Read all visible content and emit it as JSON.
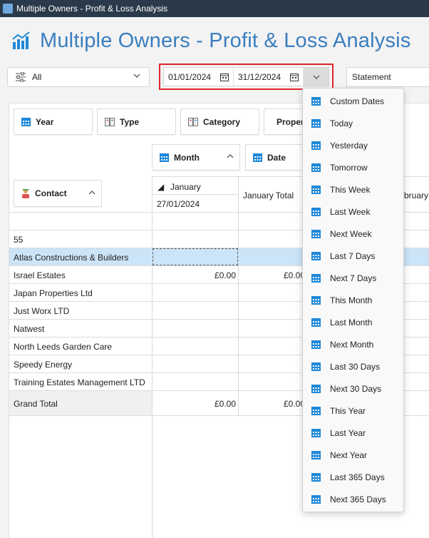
{
  "window": {
    "title": "Multiple Owners - Profit & Loss Analysis"
  },
  "header": {
    "title": "Multiple Owners - Profit & Loss Analysis"
  },
  "filters": {
    "owner_filter": "All",
    "start_date": "01/01/2024",
    "end_date": "31/12/2024",
    "report": "Statement"
  },
  "pivot": {
    "fields": {
      "year": "Year",
      "type": "Type",
      "category": "Category",
      "property": "Property",
      "month": "Month",
      "date": "Date",
      "contact": "Contact"
    },
    "column_headers": {
      "january": "January",
      "january_date": "27/01/2024",
      "january_total": "January Total",
      "february": "February"
    },
    "rows": [
      {
        "contact": "",
        "jan_value": "",
        "jan_total": ""
      },
      {
        "contact": "55",
        "jan_value": "",
        "jan_total": ""
      },
      {
        "contact": "Atlas Constructions & Builders",
        "jan_value": "",
        "jan_total": ""
      },
      {
        "contact": "Israel Estates",
        "jan_value": "£0.00",
        "jan_total": "£0.00"
      },
      {
        "contact": "Japan Properties Ltd",
        "jan_value": "",
        "jan_total": ""
      },
      {
        "contact": "Just Worx LTD",
        "jan_value": "",
        "jan_total": ""
      },
      {
        "contact": "Natwest",
        "jan_value": "",
        "jan_total": ""
      },
      {
        "contact": "North Leeds Garden Care",
        "jan_value": "",
        "jan_total": ""
      },
      {
        "contact": "Speedy Energy",
        "jan_value": "",
        "jan_total": ""
      },
      {
        "contact": "Training Estates Management LTD",
        "jan_value": "",
        "jan_total": ""
      }
    ],
    "grand_total": {
      "label": "Grand Total",
      "jan_value": "£0.00",
      "jan_total": "£0.00"
    }
  },
  "date_presets": [
    "Custom Dates",
    "Today",
    "Yesterday",
    "Tomorrow",
    "This Week",
    "Last Week",
    "Next Week",
    "Last 7 Days",
    "Next 7 Days",
    "This Month",
    "Last Month",
    "Next Month",
    "Last 30 Days",
    "Next 30 Days",
    "This Year",
    "Last Year",
    "Next Year",
    "Last 365 Days",
    "Next 365 Days"
  ],
  "colors": {
    "accent": "#3a7ebf",
    "highlight_border": "#e0242b",
    "row_selected": "#cce4f7",
    "calendar_icon": "#1e88d8"
  }
}
